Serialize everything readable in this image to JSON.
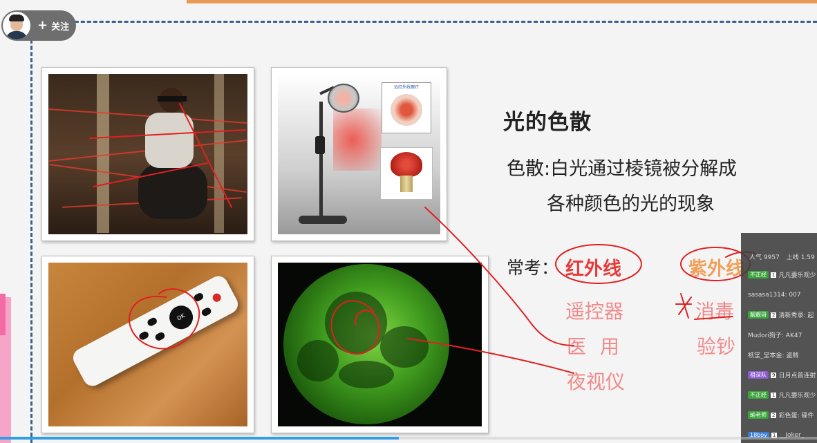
{
  "header": {
    "follow_label": "关注"
  },
  "slide": {
    "title": "光的色散",
    "definition_line1": "色散:白光通过棱镜被分解成",
    "definition_line2": "各种颜色的光的现象",
    "exam_label": "常考：",
    "infrared_label": "红外线",
    "ultraviolet_label": "紫外线",
    "infrared_uses": [
      "遥控器",
      "医用",
      "夜视仪"
    ],
    "ultraviolet_uses": [
      "消毒",
      "验钞"
    ],
    "lamp_inset_caption": "远红外线理疗"
  },
  "photos": [
    {
      "name": "laser-room",
      "icon": "laser-photo"
    },
    {
      "name": "infrared-lamp",
      "icon": "lamp-photo"
    },
    {
      "name": "remote-control",
      "icon": "remote-photo",
      "ok_label": "OK"
    },
    {
      "name": "night-vision",
      "icon": "night-vision-photo"
    }
  ],
  "chat": {
    "viewers_label": "人气",
    "viewers": "9957",
    "online_label": "上线",
    "online": "1.59",
    "messages": [
      {
        "badge": "不正经",
        "level": "1",
        "text": "凡凡要乐观少"
      },
      {
        "badge": "",
        "level": "",
        "text": "sasasa1314: 007"
      },
      {
        "badge": "靓靓哥",
        "level": "2",
        "text": "清新秀录: 起"
      },
      {
        "badge": "",
        "level": "",
        "text": "Mudori狗子: AK47"
      },
      {
        "badge": "",
        "level": "",
        "text": "祇堂_堂本金: 盗贼"
      },
      {
        "badge": "祖深队",
        "level": "9",
        "text": "日月点普连射"
      },
      {
        "badge": "不正经",
        "level": "1",
        "text": "凡凡要乐观少"
      },
      {
        "badge": "瑜老师",
        "level": "2",
        "text": "彩色蛋: 碟件"
      },
      {
        "badge": "18boy",
        "level": "1",
        "text": "__Joker_"
      }
    ]
  },
  "playback": {
    "progress_fraction": 0.488
  },
  "colors": {
    "accent_top": "#e89a55",
    "dash_border": "#3c5f8c",
    "annotation_red": "#e02020",
    "progress": "#2f9ee8"
  }
}
